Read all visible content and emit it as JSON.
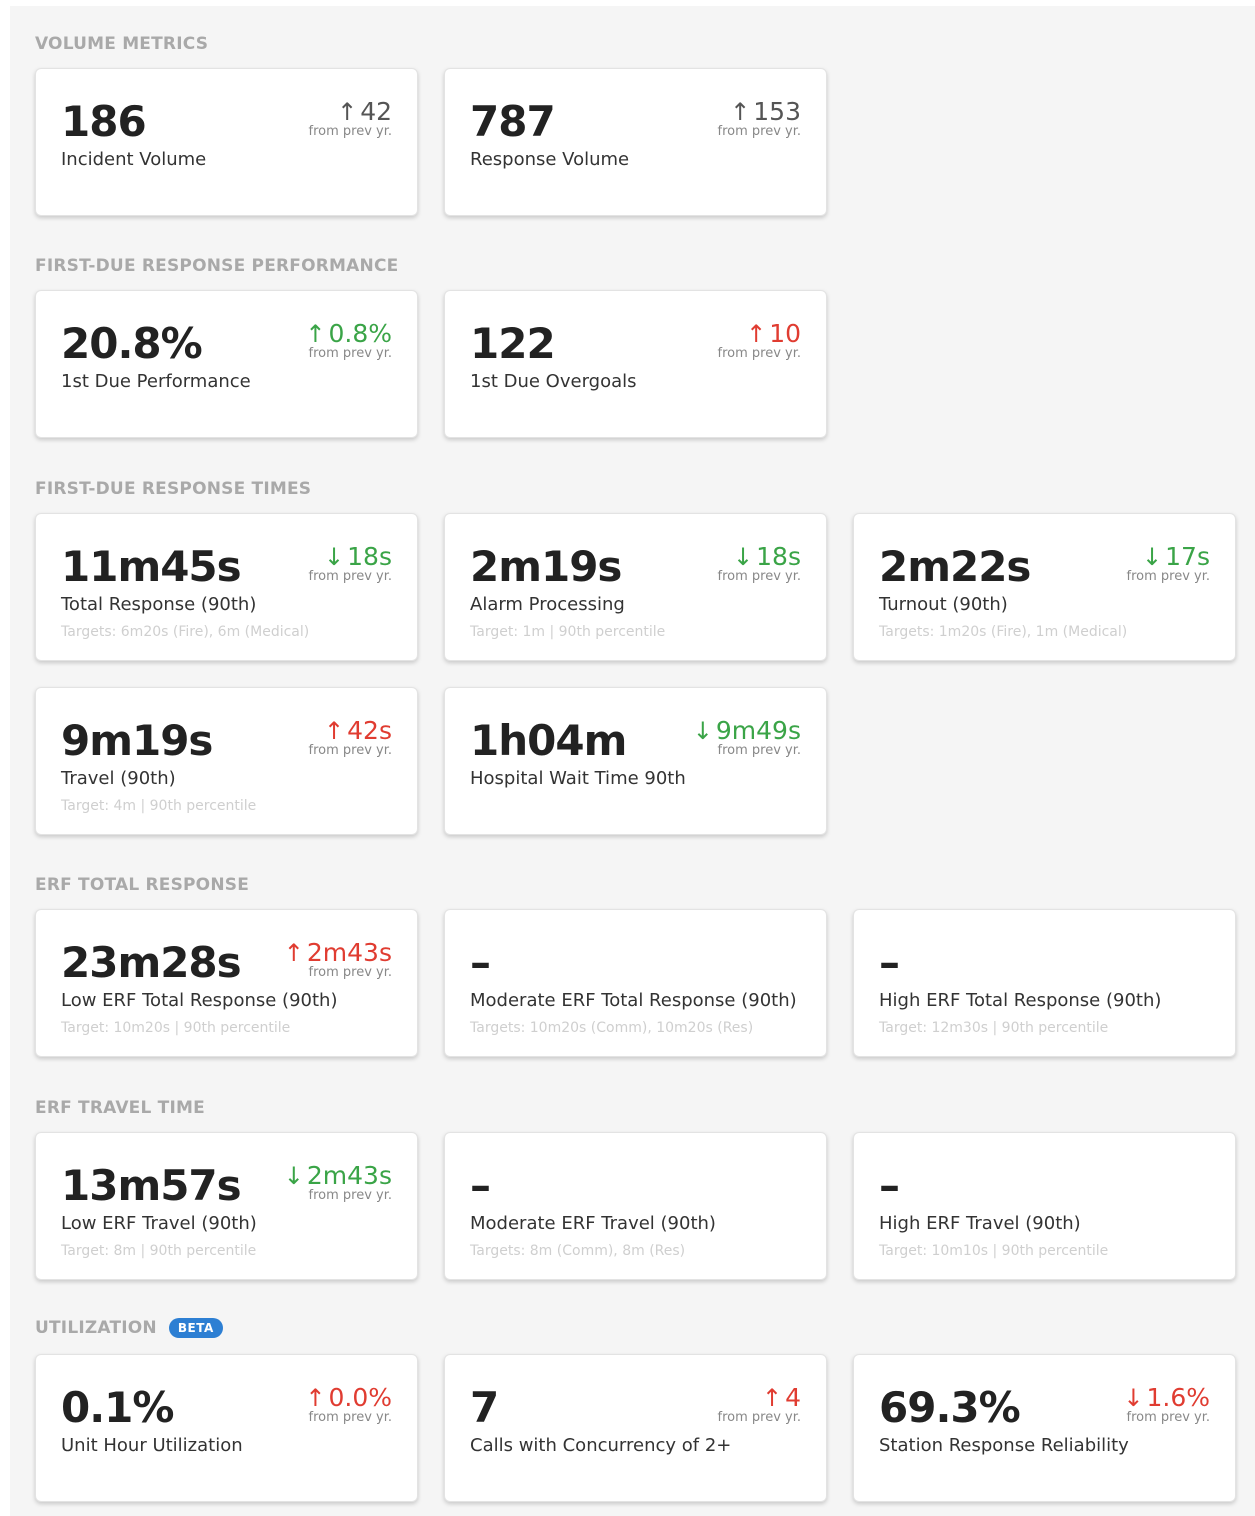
{
  "sections": {
    "volume": "VOLUME METRICS",
    "first_due_perf": "FIRST-DUE RESPONSE PERFORMANCE",
    "first_due_times": "FIRST-DUE RESPONSE TIMES",
    "erf_total": "ERF TOTAL RESPONSE",
    "erf_travel": "ERF TRAVEL TIME",
    "utilization": "UTILIZATION",
    "utilization_badge": "BETA"
  },
  "from_text": "from prev yr.",
  "arrows": {
    "up": "↑",
    "down": "↓"
  },
  "colors": {
    "good": "#3aa447",
    "bad": "#e03c31",
    "neutral": "#555555",
    "badge": "#2d7fd3"
  },
  "cards": {
    "incident_volume": {
      "value": "186",
      "label": "Incident Volume",
      "delta": "42"
    },
    "response_volume": {
      "value": "787",
      "label": "Response Volume",
      "delta": "153"
    },
    "first_due_performance": {
      "value": "20.8%",
      "label": "1st Due Performance",
      "delta": "0.8%"
    },
    "first_due_overgoals": {
      "value": "122",
      "label": "1st Due Overgoals",
      "delta": "10"
    },
    "total_response": {
      "value": "11m45s",
      "label": "Total Response (90th)",
      "target": "Targets: 6m20s (Fire), 6m (Medical)",
      "delta": "18s"
    },
    "alarm_processing": {
      "value": "2m19s",
      "label": "Alarm Processing",
      "target": "Target: 1m | 90th percentile",
      "delta": "18s"
    },
    "turnout": {
      "value": "2m22s",
      "label": "Turnout (90th)",
      "target": "Targets: 1m20s (Fire), 1m (Medical)",
      "delta": "17s"
    },
    "travel": {
      "value": "9m19s",
      "label": "Travel (90th)",
      "target": "Target: 4m | 90th percentile",
      "delta": "42s"
    },
    "hospital_wait": {
      "value": "1h04m",
      "label": "Hospital Wait Time 90th",
      "delta": "9m49s"
    },
    "low_erf_total": {
      "value": "23m28s",
      "label": "Low ERF Total Response (90th)",
      "target": "Target: 10m20s | 90th percentile",
      "delta": "2m43s"
    },
    "moderate_erf_total": {
      "value": "–",
      "label": "Moderate ERF Total Response (90th)",
      "target": "Targets: 10m20s (Comm), 10m20s (Res)"
    },
    "high_erf_total": {
      "value": "–",
      "label": "High ERF Total Response (90th)",
      "target": "Target: 12m30s | 90th percentile"
    },
    "low_erf_travel": {
      "value": "13m57s",
      "label": "Low ERF Travel (90th)",
      "target": "Target: 8m | 90th percentile",
      "delta": "2m43s"
    },
    "moderate_erf_travel": {
      "value": "–",
      "label": "Moderate ERF Travel (90th)",
      "target": "Targets: 8m (Comm), 8m (Res)"
    },
    "high_erf_travel": {
      "value": "–",
      "label": "High ERF Travel (90th)",
      "target": "Target: 10m10s | 90th percentile"
    },
    "unit_hour_utilization": {
      "value": "0.1%",
      "label": "Unit Hour Utilization",
      "delta": "0.0%"
    },
    "concurrency_calls": {
      "value": "7",
      "label": "Calls with Concurrency of 2+",
      "delta": "4"
    },
    "station_reliability": {
      "value": "69.3%",
      "label": "Station Response Reliability",
      "delta": "1.6%"
    }
  }
}
